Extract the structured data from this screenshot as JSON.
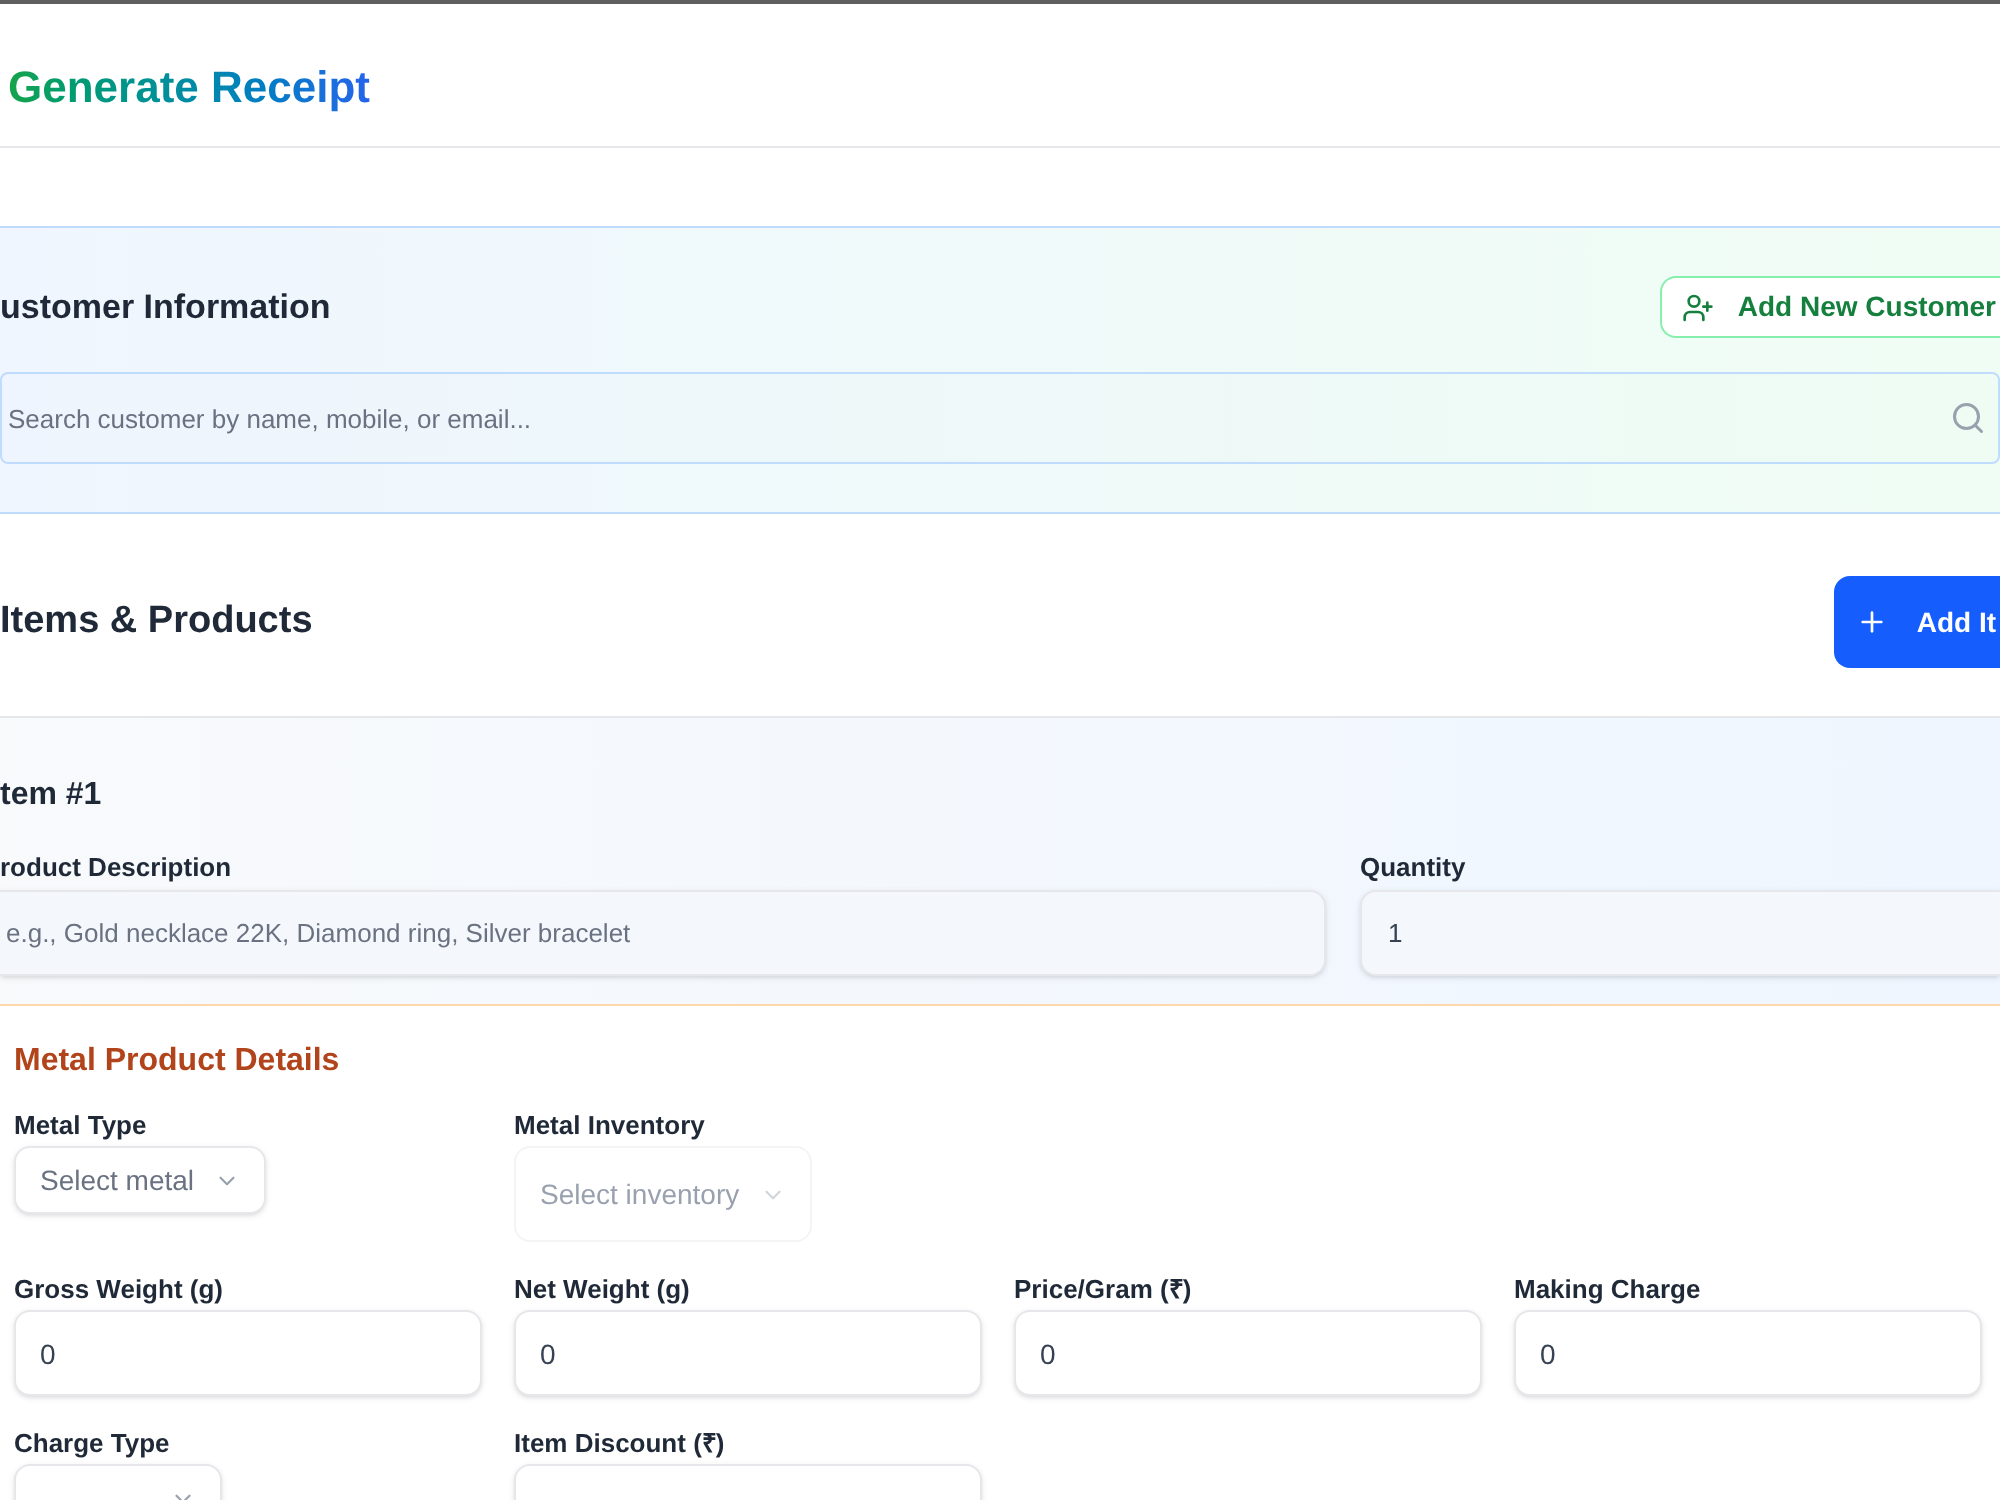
{
  "page": {
    "title": "Generate Receipt"
  },
  "customer_section": {
    "title": "ustomer Information",
    "add_button": "Add New Customer",
    "search": {
      "placeholder": "Search customer by name, mobile, or email..."
    }
  },
  "items_section": {
    "title": "Items & Products",
    "add_button": "Add It"
  },
  "items": [
    {
      "title": "tem #1",
      "fields": [
        {
          "label": "roduct Description",
          "placeholder": "e.g., Gold necklace 22K, Diamond ring, Silver bracelet"
        },
        {
          "label": "Quantity",
          "value": "1"
        }
      ],
      "metal_details": {
        "title": "Metal Product Details",
        "rows": [
          [
            {
              "kind": "select",
              "label": "Metal Type",
              "placeholder": "Select metal",
              "disabled": false
            },
            {
              "kind": "select",
              "label": "Metal Inventory",
              "placeholder": "Select inventory",
              "disabled": true
            }
          ],
          [
            {
              "kind": "input",
              "label": "Gross Weight (g)",
              "value": "0"
            },
            {
              "kind": "input",
              "label": "Net Weight (g)",
              "value": "0"
            },
            {
              "kind": "input",
              "label": "Price/Gram (₹)",
              "value": "0"
            },
            {
              "kind": "input",
              "label": "Making Charge",
              "value": "0"
            }
          ],
          [
            {
              "kind": "select",
              "label": "Charge Type",
              "disabled": false
            },
            {
              "kind": "input",
              "label": "Item Discount (₹)"
            }
          ]
        ]
      }
    }
  ]
}
